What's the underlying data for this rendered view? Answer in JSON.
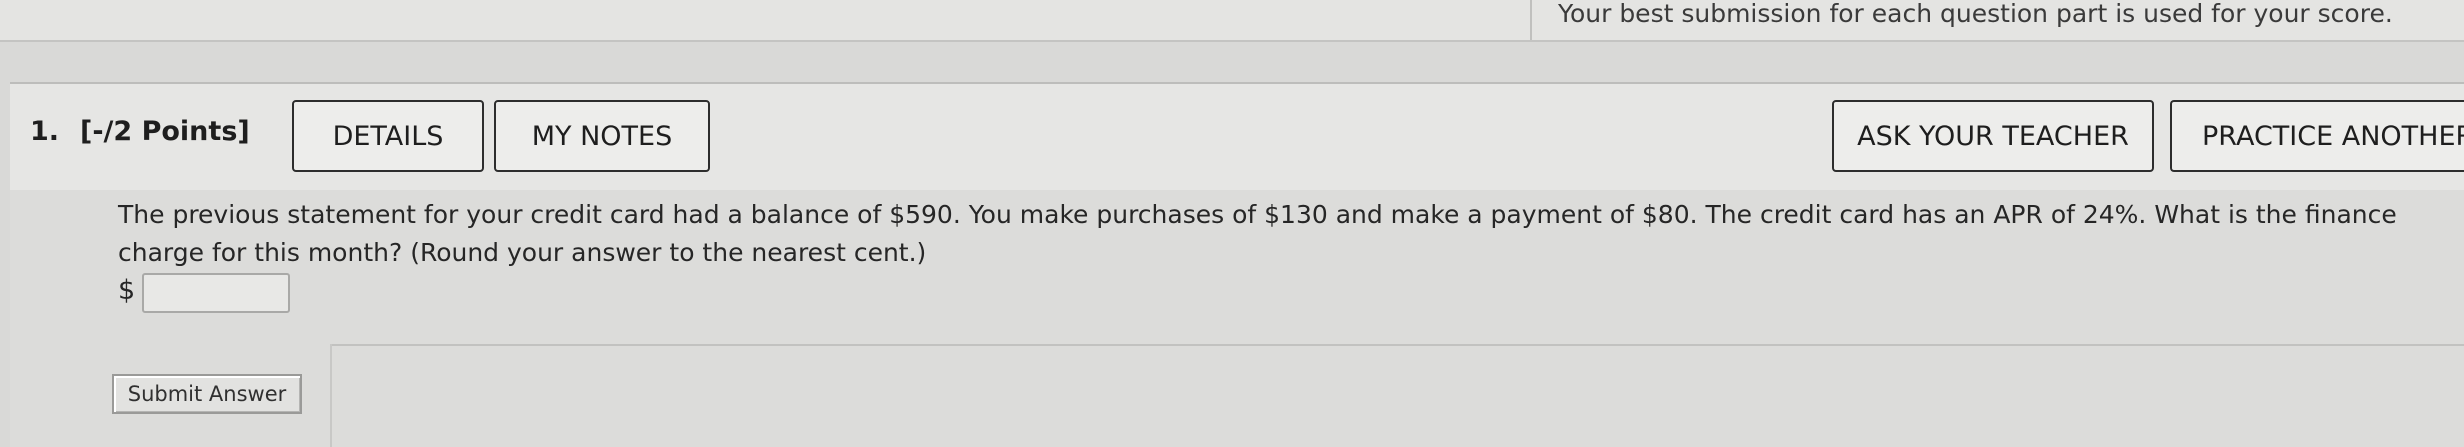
{
  "header": {
    "score_note": "Your best submission for each question part is used for your score."
  },
  "question": {
    "number": "1.",
    "points": "[-/2 Points]",
    "buttons": {
      "details": "DETAILS",
      "my_notes": "MY NOTES",
      "ask_teacher": "ASK YOUR TEACHER",
      "practice_another": "PRACTICE ANOTHER"
    },
    "text": "The previous statement for your credit card had a balance of $590. You make purchases of $130 and make a payment of $80. The credit card has an APR of 24%. What is the finance charge for this month? (Round your answer to the nearest cent.)",
    "answer": {
      "currency_symbol": "$",
      "value": ""
    },
    "submit_label": "Submit Answer"
  }
}
